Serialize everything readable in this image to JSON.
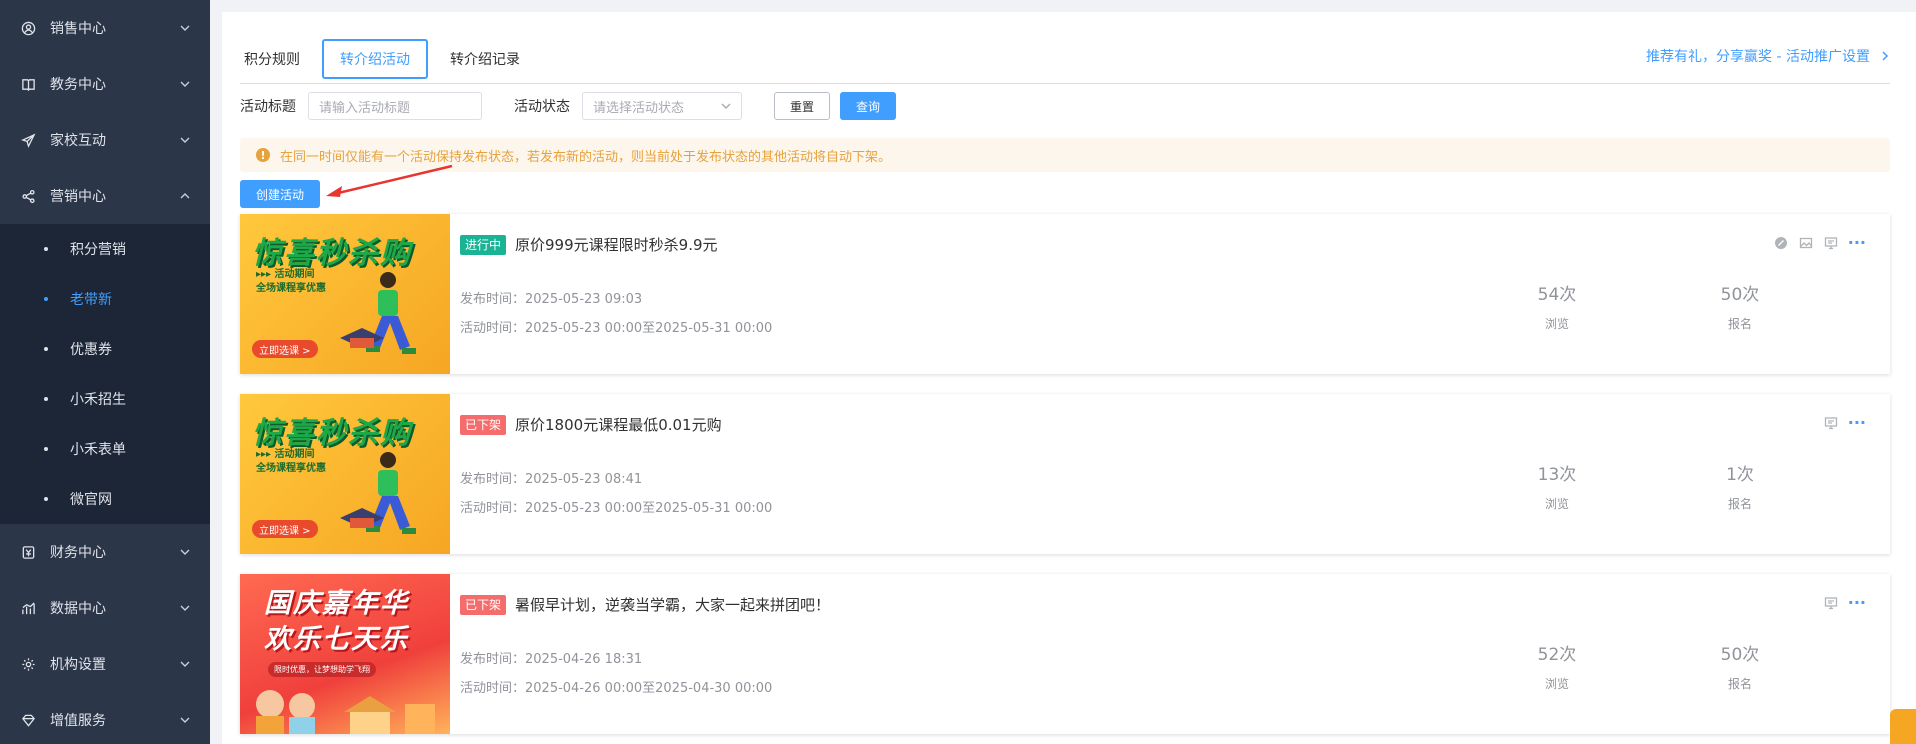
{
  "sidebar": {
    "items": [
      {
        "label": "销售中心",
        "icon": "user-circle-icon",
        "expanded": false
      },
      {
        "label": "教务中心",
        "icon": "book-icon",
        "expanded": false
      },
      {
        "label": "家校互动",
        "icon": "paper-plane-icon",
        "expanded": false
      },
      {
        "label": "营销中心",
        "icon": "share-icon",
        "expanded": true
      },
      {
        "label": "财务中心",
        "icon": "finance-icon",
        "expanded": false
      },
      {
        "label": "数据中心",
        "icon": "chart-icon",
        "expanded": false
      },
      {
        "label": "机构设置",
        "icon": "gear-icon",
        "expanded": false
      },
      {
        "label": "增值服务",
        "icon": "diamond-icon",
        "expanded": false
      }
    ],
    "marketing_sub": [
      {
        "label": "积分营销",
        "active": false
      },
      {
        "label": "老带新",
        "active": true
      },
      {
        "label": "优惠券",
        "active": false
      },
      {
        "label": "小禾招生",
        "active": false
      },
      {
        "label": "小禾表单",
        "active": false
      },
      {
        "label": "微官网",
        "active": false
      }
    ]
  },
  "tabs": [
    {
      "label": "积分规则",
      "active": false
    },
    {
      "label": "转介绍活动",
      "active": true
    },
    {
      "label": "转介绍记录",
      "active": false
    }
  ],
  "promo_link": "推荐有礼，分享赢奖 - 活动推广设置",
  "filter": {
    "title_label": "活动标题",
    "title_placeholder": "请输入活动标题",
    "status_label": "活动状态",
    "status_placeholder": "请选择活动状态",
    "reset": "重置",
    "query": "查询"
  },
  "notice": "在同一时间仅能有一个活动保持发布状态，若发布新的活动，则当前处于发布状态的其他活动将自动下架。",
  "create_button": "创建活动",
  "activities": [
    {
      "status": "进行中",
      "title": "原价999元课程限时秒杀9.9元",
      "publish_time": "发布时间：2025-05-23 09:03",
      "activity_time": "活动时间：2025-05-23 00:00至2025-05-31 00:00",
      "views": "54次",
      "views_label": "浏览",
      "signups": "50次",
      "signups_label": "报名",
      "thumb": {
        "headline": "惊喜秒杀购",
        "line1": "▸▸▸ 活动期间",
        "line2": "全场课程享优惠",
        "btn": "立即选课 >"
      }
    },
    {
      "status": "已下架",
      "title": "原价1800元课程最低0.01元购",
      "publish_time": "发布时间：2025-05-23 08:41",
      "activity_time": "活动时间：2025-05-23 00:00至2025-05-31 00:00",
      "views": "13次",
      "views_label": "浏览",
      "signups": "1次",
      "signups_label": "报名",
      "thumb": {
        "headline": "惊喜秒杀购",
        "line1": "▸▸▸ 活动期间",
        "line2": "全场课程享优惠",
        "btn": "立即选课 >"
      }
    },
    {
      "status": "已下架",
      "title": "暑假早计划，逆袭当学霸，大家一起来拼团吧！",
      "publish_time": "发布时间：2025-04-26 18:31",
      "activity_time": "活动时间：2025-04-26 00:00至2025-04-30 00:00",
      "views": "52次",
      "views_label": "浏览",
      "signups": "50次",
      "signups_label": "报名",
      "thumb": {
        "headline1": "国庆嘉年华",
        "headline2": "欢乐七天乐",
        "sub": "限时优惠，让梦想助学飞翔"
      }
    }
  ],
  "colors": {
    "primary": "#409eff",
    "sidebar": "#2b3648",
    "submenu": "#1d2636",
    "warning": "#e6a23c",
    "running": "#1ab394",
    "offline": "#f56c6c"
  }
}
